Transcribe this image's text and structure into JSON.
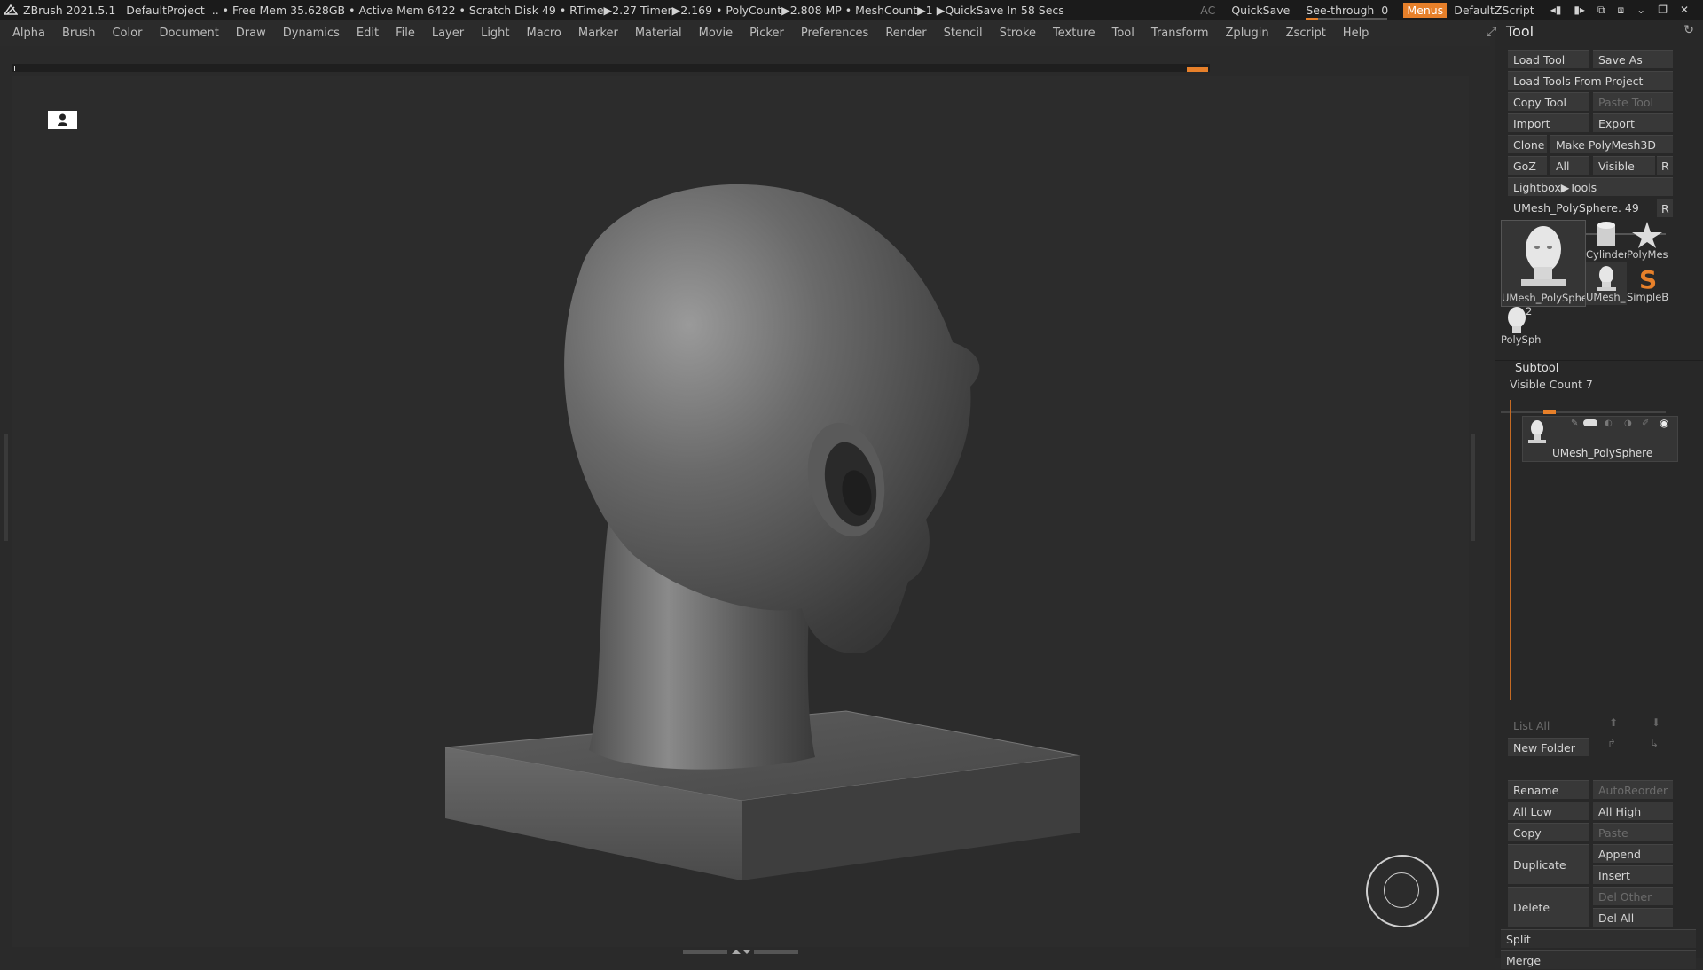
{
  "titlebar": {
    "app": "ZBrush 2021.5.1",
    "project": "DefaultProject",
    "stats": ".. • Free Mem 35.628GB • Active Mem 6422 • Scratch Disk 49 •  RTime▶2.27 Timer▶2.169 • PolyCount▶2.808 MP  • MeshCount▶1  ▶QuickSave In 58 Secs",
    "ac": "AC",
    "quicksave": "QuickSave",
    "seethrough_label": "See-through",
    "seethrough_value": "0",
    "menus": "Menus",
    "zscript": "DefaultZScript"
  },
  "menubar": [
    "Alpha",
    "Brush",
    "Color",
    "Document",
    "Draw",
    "Dynamics",
    "Edit",
    "File",
    "Layer",
    "Light",
    "Macro",
    "Marker",
    "Material",
    "Movie",
    "Picker",
    "Preferences",
    "Render",
    "Stencil",
    "Stroke",
    "Texture",
    "Tool",
    "Transform",
    "Zplugin",
    "Zscript",
    "Help"
  ],
  "tool_panel": {
    "title": "Tool",
    "load_tool": "Load Tool",
    "save_as": "Save As",
    "load_tools_from_project": "Load Tools From Project",
    "copy_tool": "Copy Tool",
    "paste_tool": "Paste Tool",
    "import": "Import",
    "export": "Export",
    "clone": "Clone",
    "make_polymesh": "Make PolyMesh3D",
    "goz": "GoZ",
    "all": "All",
    "visible": "Visible",
    "r": "R",
    "lightbox_tools": "Lightbox▶Tools",
    "current_tool": "UMesh_PolySphere. 49",
    "thumbs": {
      "main": "UMesh_PolySphere",
      "cylinder": "Cylinder",
      "polymesh": "PolyMes",
      "umesh_small": "UMesh_",
      "simpleb": "SimpleB",
      "polysph": "PolySph",
      "polysph_count": "2"
    }
  },
  "subtool": {
    "header": "Subtool",
    "visible_count": "Visible Count 7",
    "item_name": "UMesh_PolySphere",
    "list_all": "List All",
    "new_folder": "New Folder",
    "rename": "Rename",
    "autoreorder": "AutoReorder",
    "all_low": "All Low",
    "all_high": "All High",
    "copy": "Copy",
    "paste": "Paste",
    "duplicate": "Duplicate",
    "append": "Append",
    "insert": "Insert",
    "delete": "Delete",
    "del_other": "Del Other",
    "del_all": "Del All",
    "split": "Split",
    "merge": "Merge"
  }
}
